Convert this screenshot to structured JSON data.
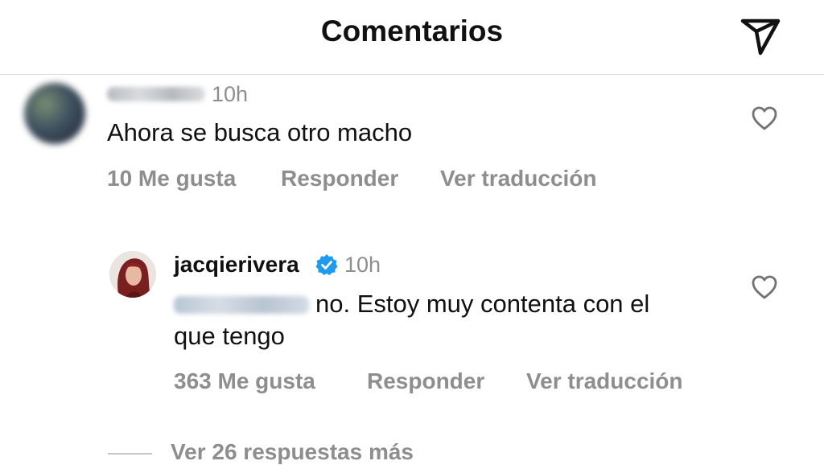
{
  "header": {
    "title": "Comentarios",
    "send_icon": "paper-plane-icon"
  },
  "comments": [
    {
      "time": "10h",
      "text": "Ahora se busca otro macho",
      "likes": "10 Me gusta",
      "reply": "Responder",
      "translate": "Ver traducción"
    }
  ],
  "reply": {
    "username": "jacqierivera",
    "verified_icon": "verified-badge-icon",
    "time": "10h",
    "text_line1": "no. Estoy muy contenta con el",
    "text_line2": "que tengo",
    "likes": "363 Me gusta",
    "reply": "Responder",
    "translate": "Ver traducción"
  },
  "view_more": "Ver 26 respuestas más",
  "colors": {
    "verified": "#1d9bf0",
    "muted": "#8e8e8e"
  }
}
